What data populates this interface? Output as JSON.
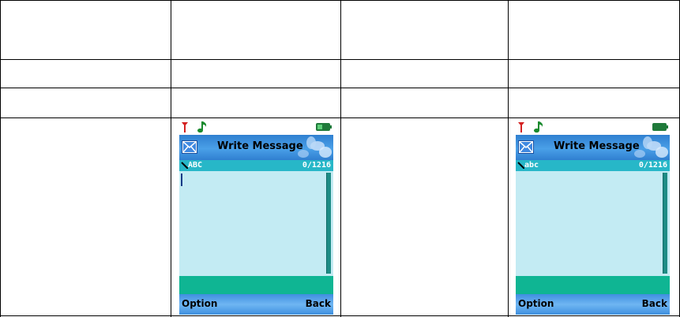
{
  "screens": [
    {
      "title": "Write Message",
      "input_mode": "ABC",
      "char_count": "0/1216",
      "softkey_left": "Option",
      "softkey_right": "Back",
      "show_cursor": true
    },
    {
      "title": "Write Message",
      "input_mode": "abc",
      "char_count": "0/1216",
      "softkey_left": "Option",
      "softkey_right": "Back",
      "show_cursor": false
    }
  ],
  "icons": {
    "signal": "antenna-icon",
    "music": "music-note-icon",
    "battery": "battery-icon",
    "message": "envelope-icon",
    "input": "pen-icon"
  },
  "colors": {
    "title_bar": "#4aa0e8",
    "info_bar": "#27b7c8",
    "text_area": "#c3ebf3",
    "green_bar": "#0fb593",
    "battery": "#1f7a3a"
  }
}
